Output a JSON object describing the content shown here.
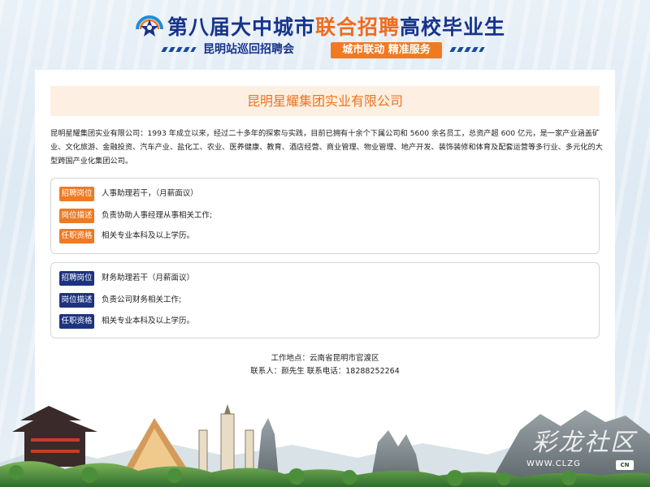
{
  "header": {
    "title_part1": "第八届大中城市",
    "title_part2": "联合招聘",
    "title_part3": "高校毕业生",
    "subtitle": "昆明站巡回招聘会",
    "tag": "城市联动 精准服务"
  },
  "company": {
    "name": "昆明星耀集团实业有限公司",
    "intro": "昆明星耀集团实业有限公司：1993 年成立以来，经过二十多年的探索与实践，目前已拥有十余个下属公司和 5600 余名员工，总资产超 600 亿元，是一家产业涵盖矿业、文化旅游、金融投资、汽车产业、盐化工、农业、医养健康、教育、酒店经营、商业管理、物业管理、地产开发、装饰装修和体育及配套运营等多行业、多元化的大型跨国产业化集团公司。"
  },
  "jobs": [
    {
      "label_position": "招聘岗位",
      "position": "人事助理若干，（月薪面议）",
      "label_desc": "岗位描述",
      "desc": "负责协助人事经理从事相关工作;",
      "label_req": "任职资格",
      "req": "相关专业本科及以上学历。",
      "color": "#f07a22"
    },
    {
      "label_position": "招聘岗位",
      "position": "财务助理若干（月薪面议）",
      "label_desc": "岗位描述",
      "desc": "负责公司财务相关工作;",
      "label_req": "任职资格",
      "req": "相关专业本科及以上学历。",
      "color": "#1d3380"
    }
  ],
  "footer": {
    "location": "工作地点：云南省昆明市官渡区",
    "contact": "联系人：颜先生  联系电话：18288252264"
  },
  "watermark": {
    "text": "彩龙社区",
    "url": "WWW.CLZG",
    "cn": "CN"
  }
}
